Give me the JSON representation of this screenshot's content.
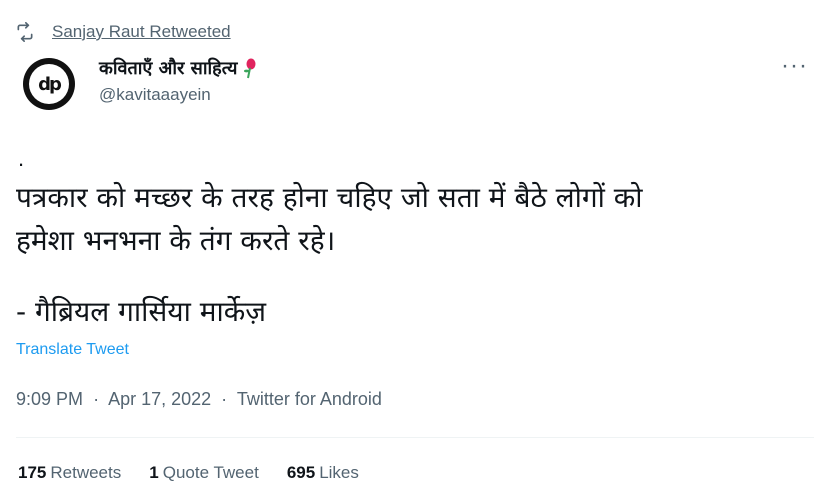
{
  "retweet": {
    "label": "Sanjay Raut Retweeted",
    "icon": "retweet-icon"
  },
  "author": {
    "avatar_text": "dp",
    "display_name": "कविताएँ और साहित्य",
    "name_emoji_icon": "rose-icon",
    "handle": "@kavitaaayein"
  },
  "more_label": "···",
  "tweet": {
    "dot": ".",
    "body_line1": "पत्रकार को मच्छर के तरह होना चहिए जो सता में बैठे लोगों को",
    "body_line2": "हमेशा भनभना के तंग करते रहे।",
    "attribution": "- गैब्रियल गार्सिया मार्केज़"
  },
  "translate_label": "Translate Tweet",
  "meta": {
    "time": "9:09 PM",
    "date": "Apr 17, 2022",
    "source": "Twitter for Android",
    "separator": "·"
  },
  "stats": {
    "retweets_count": "175",
    "retweets_label": "Retweets",
    "quotes_count": "1",
    "quotes_label": "Quote Tweet",
    "likes_count": "695",
    "likes_label": "Likes"
  },
  "colors": {
    "secondary": "#536471",
    "link": "#1d9bf0",
    "text": "#0f1419"
  }
}
